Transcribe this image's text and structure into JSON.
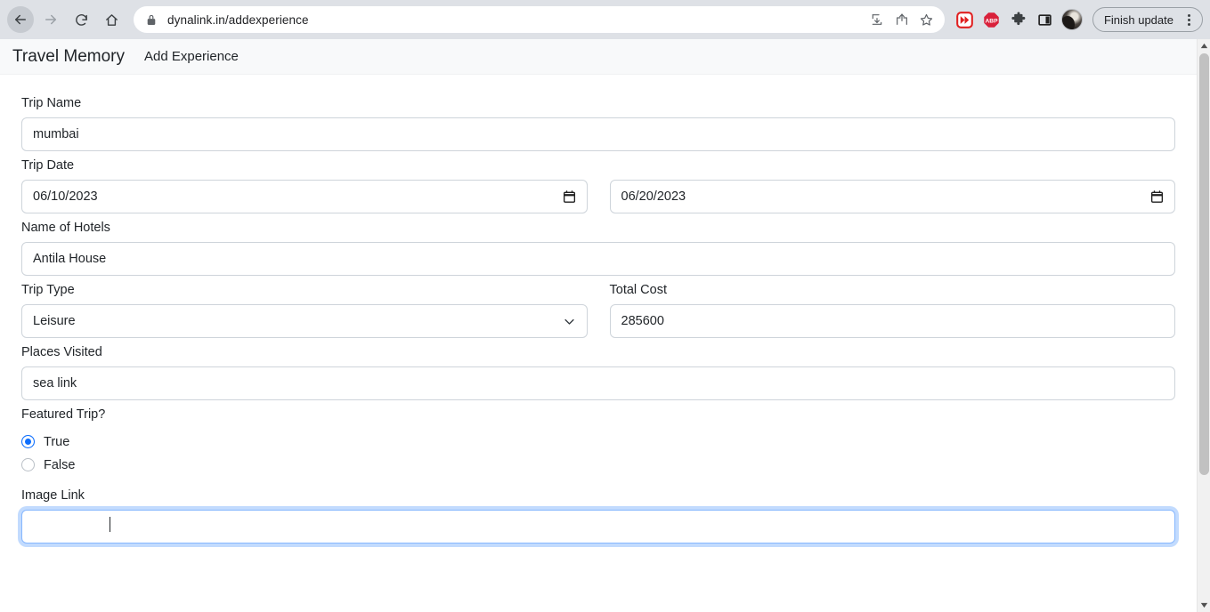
{
  "browser": {
    "url": "dynalink.in/addexperience",
    "back_icon": "back-arrow-icon",
    "forward_icon": "forward-arrow-icon",
    "reload_icon": "reload-icon",
    "home_icon": "home-icon",
    "lock_icon": "lock-icon",
    "install_icon": "install-app-icon",
    "share_icon": "share-icon",
    "bookmark_icon": "bookmark-star-icon",
    "extensions": [
      {
        "name": "fast-forward-extension-icon",
        "label": ""
      },
      {
        "name": "adblock-plus-extension-icon",
        "label": "ABP"
      },
      {
        "name": "extensions-puzzle-icon",
        "label": ""
      },
      {
        "name": "side-panel-icon",
        "label": ""
      }
    ],
    "avatar": "profile-avatar",
    "update_label": "Finish update",
    "menu_icon": "three-dot-menu-icon",
    "colors": {
      "chrome_bg": "#dee1e6",
      "extension_red": "#e02020",
      "abp_red": "#d9213b"
    }
  },
  "site": {
    "brand": "Travel Memory",
    "nav_links": [
      {
        "label": "Add Experience"
      }
    ]
  },
  "form": {
    "trip_name": {
      "label": "Trip Name",
      "value": "mumbai",
      "placeholder": ""
    },
    "trip_date": {
      "label": "Trip Date",
      "start_value": "06/10/2023",
      "end_value": "06/20/2023",
      "picker_icon": "calendar-icon"
    },
    "hotels": {
      "label": "Name of Hotels",
      "value": "Antila House",
      "placeholder": ""
    },
    "trip_type": {
      "label": "Trip Type",
      "value": "Leisure",
      "options": [
        "Leisure"
      ],
      "chevron_icon": "chevron-down-icon"
    },
    "total_cost": {
      "label": "Total Cost",
      "value": "285600",
      "placeholder": ""
    },
    "places_visited": {
      "label": "Places Visited",
      "value": "sea link",
      "placeholder": ""
    },
    "featured_trip": {
      "label": "Featured Trip?",
      "options": [
        {
          "label": "True",
          "selected": true
        },
        {
          "label": "False",
          "selected": false
        }
      ],
      "selected_color": "#0d6efd"
    },
    "image_link": {
      "label": "Image Link",
      "value": "",
      "placeholder": "",
      "focused": true,
      "focus_color": "#86b7fe"
    }
  },
  "scrollbar": {
    "up_icon": "scroll-up-arrow-icon",
    "down_icon": "scroll-down-arrow-icon",
    "thumb": "scrollbar-thumb"
  }
}
